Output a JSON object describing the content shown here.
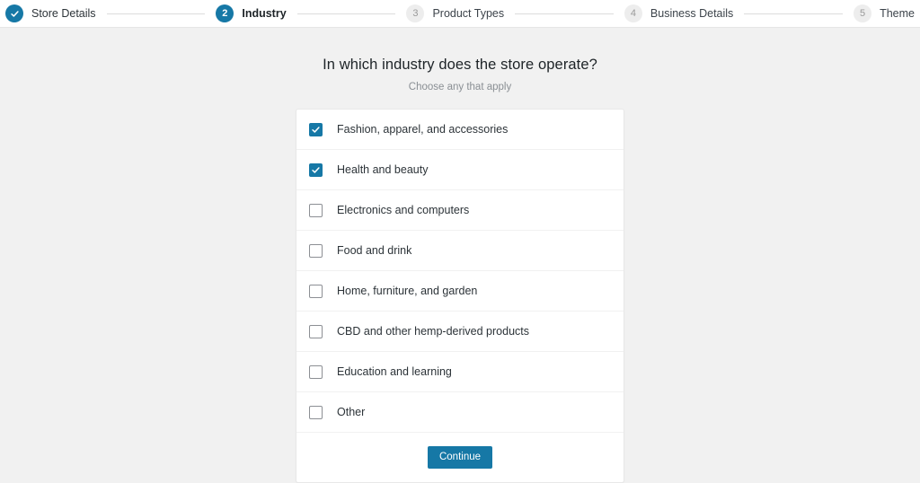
{
  "stepper": {
    "steps": [
      {
        "number": "1",
        "label": "Store Details",
        "state": "done",
        "marker": "check-icon"
      },
      {
        "number": "2",
        "label": "Industry",
        "state": "current",
        "marker": "2"
      },
      {
        "number": "3",
        "label": "Product Types",
        "state": "pending",
        "marker": "3"
      },
      {
        "number": "4",
        "label": "Business Details",
        "state": "pending",
        "marker": "4"
      },
      {
        "number": "5",
        "label": "Theme",
        "state": "pending",
        "marker": "5"
      }
    ]
  },
  "page": {
    "title": "In which industry does the store operate?",
    "subtitle": "Choose any that apply"
  },
  "card": {
    "options": [
      {
        "label": "Fashion, apparel, and accessories",
        "checked": true
      },
      {
        "label": "Health and beauty",
        "checked": true
      },
      {
        "label": "Electronics and computers",
        "checked": false
      },
      {
        "label": "Food and drink",
        "checked": false
      },
      {
        "label": "Home, furniture, and garden",
        "checked": false
      },
      {
        "label": "CBD and other hemp-derived products",
        "checked": false
      },
      {
        "label": "Education and learning",
        "checked": false
      },
      {
        "label": "Other",
        "checked": false
      }
    ],
    "continue_label": "Continue"
  },
  "colors": {
    "accent": "#1678a6",
    "page_background": "#f1f1f1",
    "card_background": "#ffffff",
    "text": "#2c3338",
    "muted_text": "#8a8f94",
    "pending_marker": "#ededed"
  }
}
